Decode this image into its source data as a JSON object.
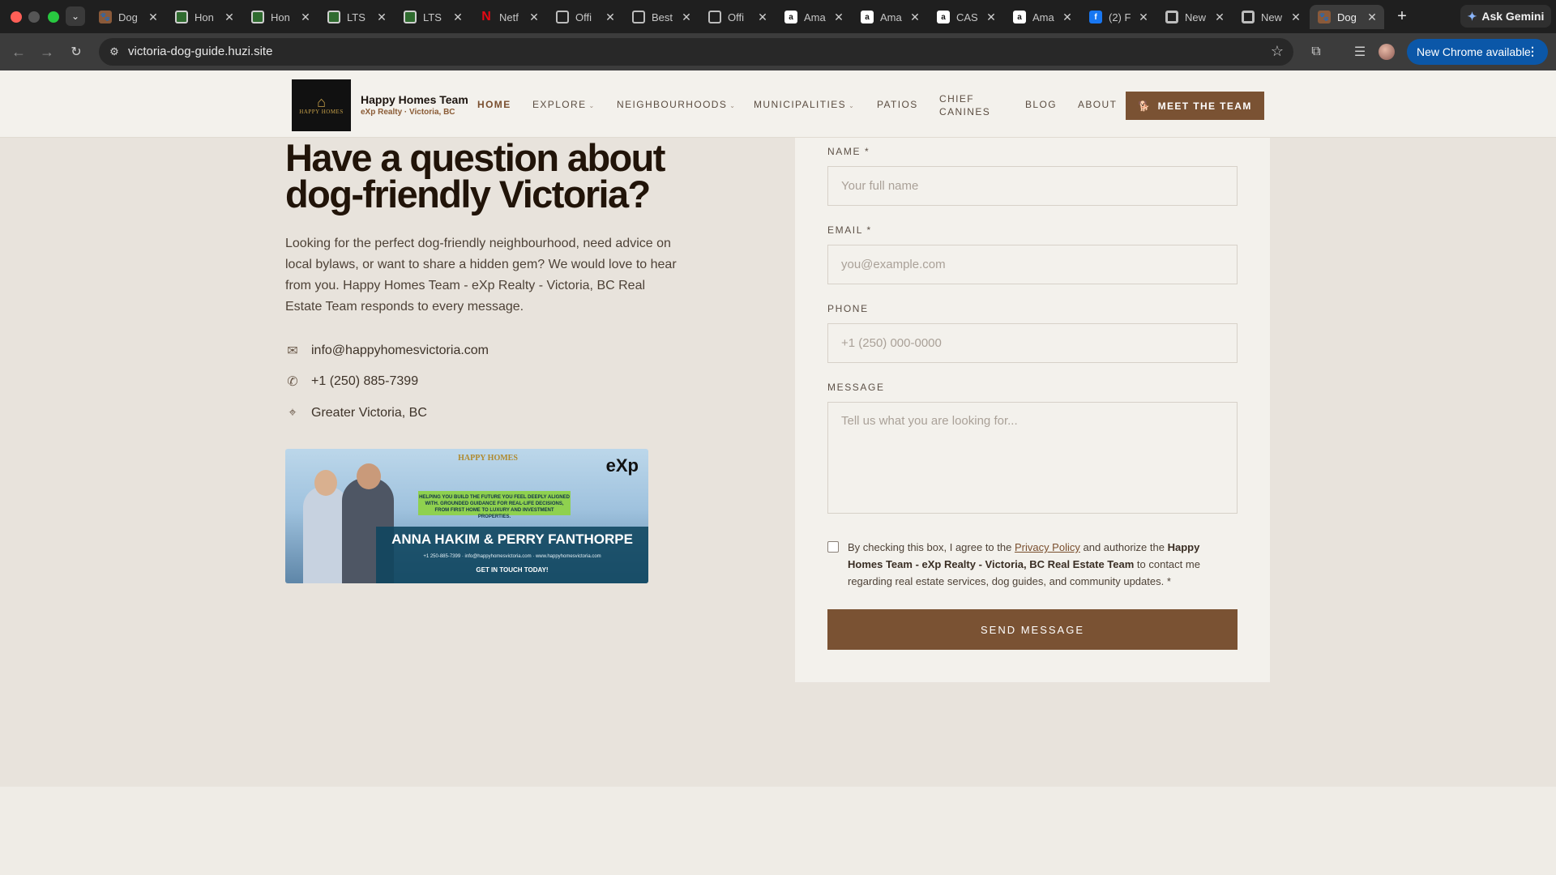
{
  "browser": {
    "tabs": [
      {
        "title": "Dog",
        "favicon": "dog-site-icon",
        "active": false
      },
      {
        "title": "Hon",
        "favicon": "green-leaf-icon",
        "active": false
      },
      {
        "title": "Hon",
        "favicon": "green-leaf-icon",
        "active": false
      },
      {
        "title": "LTS",
        "favicon": "green-leaf-icon",
        "active": false
      },
      {
        "title": "LTS",
        "favicon": "green-leaf-icon",
        "active": false
      },
      {
        "title": "Netf",
        "favicon": "netflix-icon",
        "active": false
      },
      {
        "title": "Offi",
        "favicon": "gray-circle-icon",
        "active": false
      },
      {
        "title": "Best",
        "favicon": "gray-circle-icon",
        "active": false
      },
      {
        "title": "Offi",
        "favicon": "gray-circle-icon",
        "active": false
      },
      {
        "title": "Ama",
        "favicon": "amazon-icon",
        "active": false
      },
      {
        "title": "Ama",
        "favicon": "amazon-icon",
        "active": false
      },
      {
        "title": "CAS",
        "favicon": "amazon-icon",
        "active": false
      },
      {
        "title": "Ama",
        "favicon": "amazon-icon",
        "active": false
      },
      {
        "title": "(2) F",
        "favicon": "facebook-icon",
        "active": false
      },
      {
        "title": "New",
        "favicon": "chrome-icon",
        "active": false
      },
      {
        "title": "New",
        "favicon": "chrome-icon",
        "active": false
      },
      {
        "title": "Dog",
        "favicon": "dog-site-icon",
        "active": true
      }
    ],
    "close_glyph": "✕",
    "new_tab_glyph": "+",
    "ask_gemini": "Ask Gemini",
    "url": "victoria-dog-guide.huzi.site",
    "new_chrome": "New Chrome available"
  },
  "header": {
    "logo_text": "HAPPY HOMES",
    "brand_name": "Happy Homes Team",
    "brand_sub": "eXp Realty · Victoria, BC",
    "nav": {
      "home": "HOME",
      "explore": "EXPLORE",
      "neighbourhoods": "NEIGHBOURHOODS",
      "municipalities": "MUNICIPALITIES",
      "patios": "PATIOS",
      "chief_canines": "CHIEF CANINES",
      "blog": "BLOG",
      "about": "ABOUT"
    },
    "meet_button": "MEET THE TEAM"
  },
  "contact": {
    "headline": "Have a question about dog-friendly Victoria?",
    "intro": "Looking for the perfect dog-friendly neighbourhood, need advice on local bylaws, or want to share a hidden gem? We would love to hear from you. Happy Homes Team - eXp Realty - Victoria, BC Real Estate Team responds to every message.",
    "email": "info@happyhomesvictoria.com",
    "phone": "+1 (250) 885-7399",
    "location": "Greater Victoria, BC"
  },
  "banner": {
    "logo": "HAPPY HOMES",
    "exp": "eXp",
    "tagline": "HELPING YOU BUILD THE FUTURE YOU FEEL DEEPLY ALIGNED WITH. GROUNDED GUIDANCE FOR REAL-LIFE DECISIONS, FROM FIRST HOME TO LUXURY AND INVESTMENT PROPERTIES.",
    "names": "ANNA HAKIM & PERRY FANTHORPE",
    "contacts": "+1 250-885-7399 · info@happyhomesvictoria.com · www.happyhomesvictoria.com",
    "cta": "GET IN TOUCH TODAY!"
  },
  "form": {
    "name_label": "NAME *",
    "name_placeholder": "Your full name",
    "email_label": "EMAIL *",
    "email_placeholder": "you@example.com",
    "phone_label": "PHONE",
    "phone_placeholder": "+1 (250) 000-0000",
    "message_label": "MESSAGE",
    "message_placeholder": "Tell us what you are looking for...",
    "consent_prefix": "By checking this box, I agree to the ",
    "consent_link": "Privacy Policy",
    "consent_middle": " and authorize the ",
    "consent_org": "Happy Homes Team - eXp Realty - Victoria, BC Real Estate Team",
    "consent_suffix": " to contact me regarding real estate services, dog guides, and community updates. *",
    "consent_checked": false,
    "submit": "SEND MESSAGE"
  },
  "colors": {
    "accent": "#7a5233",
    "page_bg": "#e8e3dc",
    "card_bg": "#f3f1ec"
  }
}
